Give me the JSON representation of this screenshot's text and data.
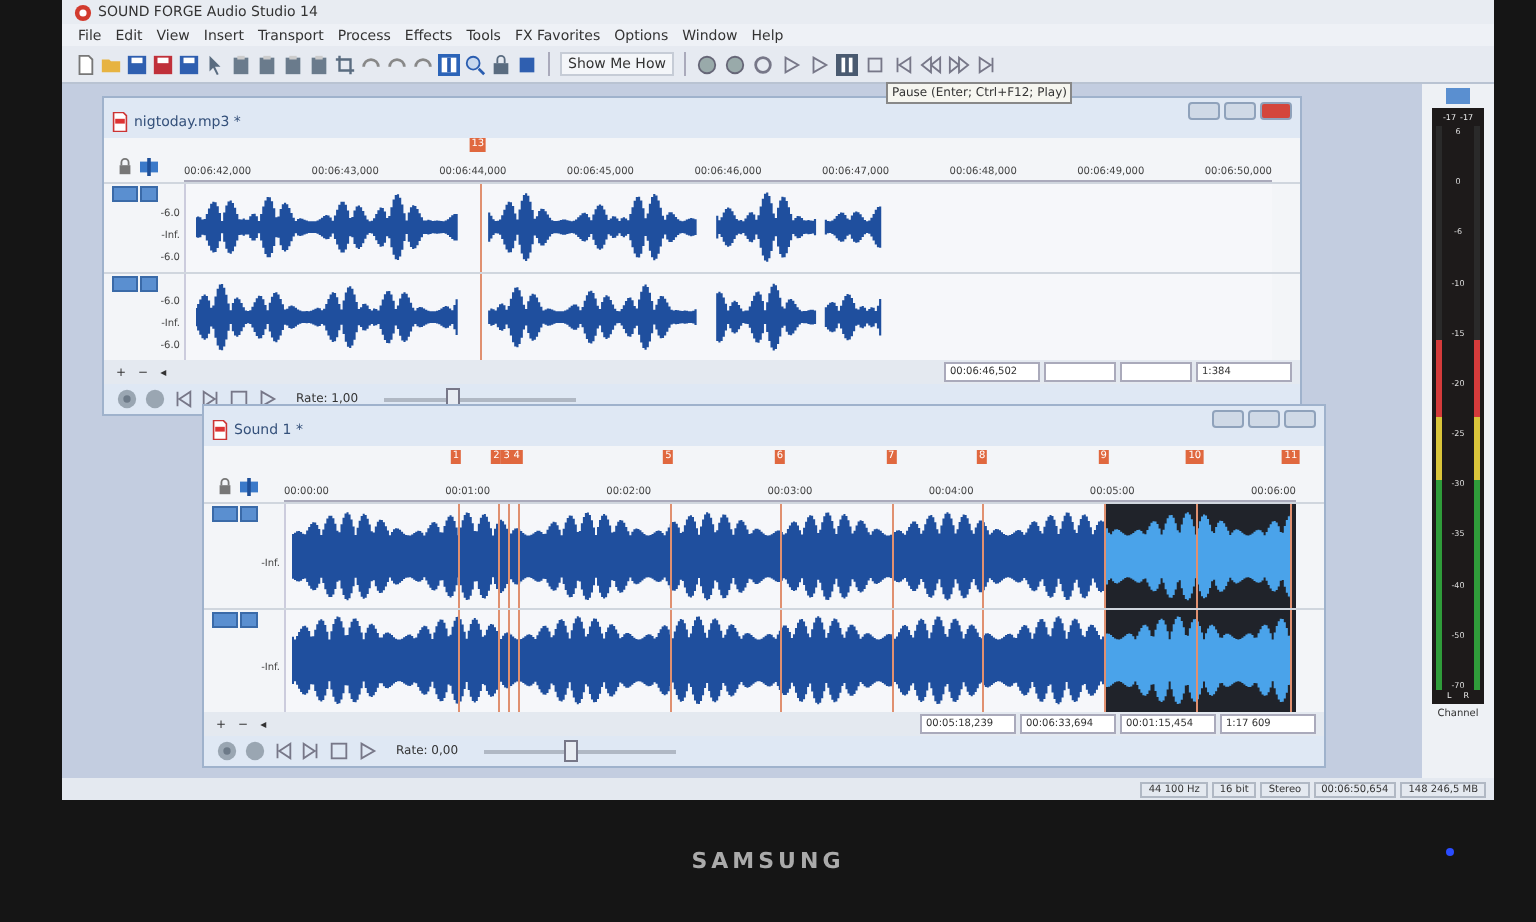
{
  "app": {
    "title": "SOUND FORGE Audio Studio 14"
  },
  "menu": [
    "File",
    "Edit",
    "View",
    "Insert",
    "Transport",
    "Process",
    "Effects",
    "Tools",
    "FX Favorites",
    "Options",
    "Window",
    "Help"
  ],
  "toolbar": {
    "show_me_how": "Show Me How",
    "tooltip": "Pause (Enter; Ctrl+F12; Play)"
  },
  "windows": [
    {
      "title": "nigtoday.mp3 *",
      "markers": [
        "13"
      ],
      "ruler": [
        "00:06:42,000",
        "00:06:43,000",
        "00:06:44,000",
        "00:06:45,000",
        "00:06:46,000",
        "00:06:47,000",
        "00:06:48,000",
        "00:06:49,000",
        "00:06:50,000"
      ],
      "channels": [
        {
          "scale": [
            "-6.0",
            "-Inf.",
            "-6.0"
          ]
        },
        {
          "scale": [
            "-6.0",
            "-Inf.",
            "-6.0"
          ]
        }
      ],
      "zoom_buttons": [
        "+",
        "−",
        "◂"
      ],
      "time_fields": [
        "00:06:46,502",
        "1:384"
      ],
      "rate": "Rate: 1,00",
      "rate_slider": {
        "level": 0.35
      }
    },
    {
      "title": "Sound 1 *",
      "markers": [
        "1",
        "2",
        "3",
        "4",
        "5",
        "6",
        "7",
        "8",
        "9",
        "10",
        "11"
      ],
      "ruler": [
        "00:00:00",
        "00:01:00",
        "00:02:00",
        "00:03:00",
        "00:04:00",
        "00:05:00",
        "00:06:00"
      ],
      "channels": [
        {
          "scale": [
            "-Inf."
          ]
        },
        {
          "scale": [
            "-Inf."
          ]
        }
      ],
      "zoom_buttons": [
        "+",
        "−",
        "◂"
      ],
      "time_fields": [
        "00:05:18,239",
        "00:06:33,694",
        "00:01:15,454",
        "1:17 609"
      ],
      "rate": "Rate: 0,00",
      "rate_slider": {
        "level": 0.45
      }
    }
  ],
  "meter": {
    "peaks": [
      "-17",
      "-17"
    ],
    "scale": [
      "6",
      "0",
      "-6",
      "-10",
      "-15",
      "-20",
      "-25",
      "-30",
      "-35",
      "-40",
      "-50",
      "-70"
    ],
    "channels": [
      {
        "label": "L",
        "level": 0.62
      },
      {
        "label": "R",
        "level": 0.62
      }
    ],
    "caption": "Channel"
  },
  "status_bar": [
    "44 100 Hz",
    "16 bit",
    "Stereo",
    "00:06:50,654",
    "148 246,5 MB"
  ],
  "monitor": {
    "brand": "SAMSUNG"
  }
}
